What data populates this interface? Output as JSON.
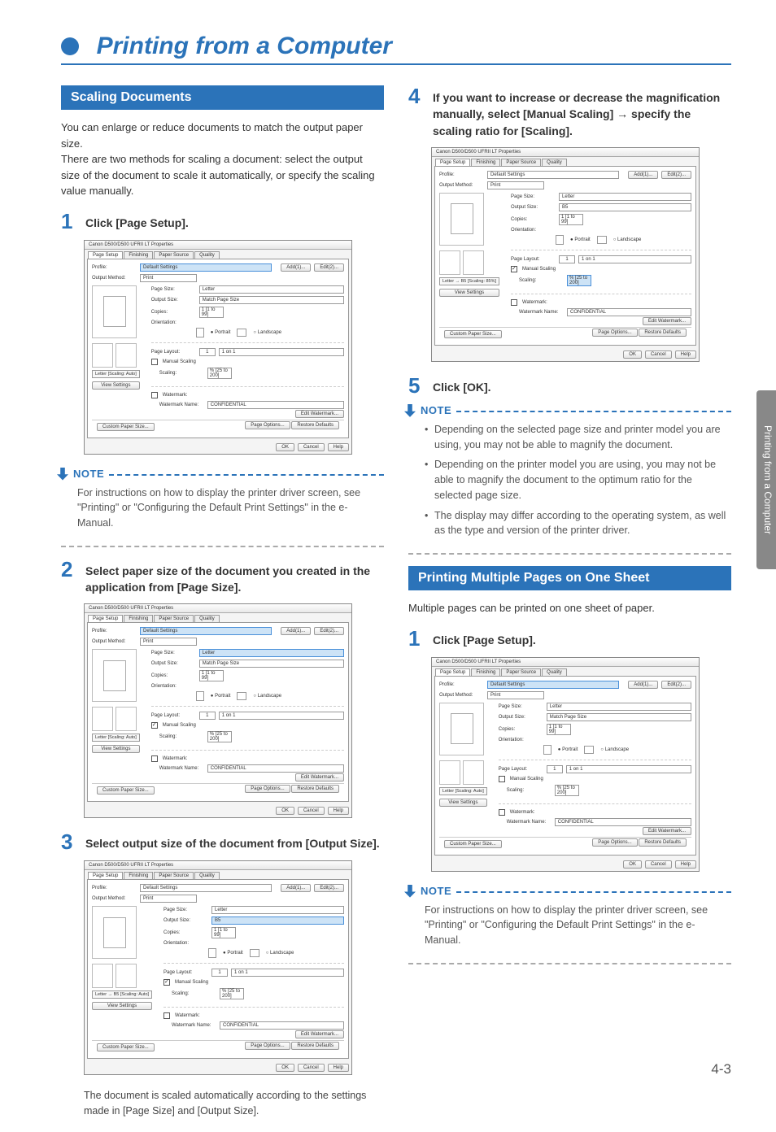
{
  "header": {
    "title": "Printing from a Computer"
  },
  "side_tab": "Printing from a Computer",
  "page_number": "4-3",
  "left": {
    "section_title": "Scaling Documents",
    "intro": "You can enlarge or reduce documents to match the output paper size.\nThere are two methods for scaling a document: select the output size of the document to scale it automatically, or specify the scaling value manually.",
    "step1": {
      "num": "1",
      "text": "Click [Page Setup]."
    },
    "step2": {
      "num": "2",
      "text": "Select paper size of the document you created in the application from [Page Size]."
    },
    "step3": {
      "num": "3",
      "text": "Select output size of the document from [Output Size]."
    },
    "step3_note": "The document is scaled automatically according to the settings made in [Page Size] and [Output Size].",
    "note_label": "NOTE",
    "note_body": "For instructions on how to display the printer driver screen, see \"Printing\" or \"Configuring the Default Print Settings\" in the e-Manual."
  },
  "right": {
    "step4": {
      "num": "4",
      "text_a": "If you want to increase or decrease the magnification manually, select [Manual Scaling] ",
      "text_b": " specify the scaling ratio for [Scaling]."
    },
    "step5": {
      "num": "5",
      "text": "Click [OK]."
    },
    "note_label": "NOTE",
    "note_bullets": [
      "Depending on the selected page size and printer model you are using, you may not be able to magnify the document.",
      "Depending on the printer model you are using, you may not be able to magnify the document to the optimum ratio for the selected page size.",
      "The display may differ according to the operating system, as well as the type and version of the printer driver."
    ],
    "section2_title": "Printing Multiple Pages on One Sheet",
    "section2_intro": "Multiple pages can be printed on one sheet of paper.",
    "step1b": {
      "num": "1",
      "text": "Click [Page Setup]."
    },
    "note2_label": "NOTE",
    "note2_body": "For instructions on how to display the printer driver screen, see \"Printing\" or \"Configuring the Default Print Settings\" in the e-Manual."
  },
  "dialog_common": {
    "title": "Canon D500/D500 UFRII LT Properties",
    "tabs": [
      "Page Setup",
      "Finishing",
      "Paper Source",
      "Quality"
    ],
    "profile_label": "Profile:",
    "profile_value": "Default Settings",
    "add_btn": "Add(1)...",
    "edit_btn": "Edit(2)...",
    "output_label": "Output Method:",
    "output_value": "Print",
    "page_size_label": "Page Size:",
    "output_size_label": "Output Size:",
    "copies_label": "Copies:",
    "copies_value": "1 [1 to 99]",
    "orientation_label": "Orientation:",
    "portrait": "Portrait",
    "landscape": "Landscape",
    "page_layout_label": "Page Layout:",
    "page_layout_value": "1 on 1",
    "manual_scaling_label": "Manual Scaling",
    "scaling_label": "Scaling:",
    "watermark_label": "Watermark:",
    "watermark_name_label": "Watermark Name:",
    "watermark_value": "CONFIDENTIAL",
    "edit_watermark_btn": "Edit Watermark...",
    "view_settings_btn": "View Settings",
    "custom_paper_btn": "Custom Paper Size...",
    "page_options_btn": "Page Options...",
    "restore_btn": "Restore Defaults",
    "ok_btn": "OK",
    "cancel_btn": "Cancel",
    "help_btn": "Help"
  },
  "dlg1": {
    "page_size_value": "Letter",
    "output_size_value": "Match Page Size",
    "scaling_value": "% [25 to 200]",
    "status": "Letter [Scaling: Auto]",
    "manual_checked": false
  },
  "dlg2": {
    "page_size_value": "Letter",
    "output_size_value": "Match Page Size",
    "scaling_value": "% [25 to 200]",
    "status": "Letter [Scaling: Auto]",
    "manual_checked": true
  },
  "dlg3": {
    "page_size_value": "Letter",
    "output_size_value": "B5",
    "scaling_value": "% [25 to 200]",
    "status": "Letter → B5 [Scaling: Auto]",
    "manual_checked": true
  },
  "dlg4": {
    "page_size_value": "Letter",
    "output_size_value": "B5",
    "scaling_value": "% [25 to 200]",
    "status": "Letter → B5 [Scaling: 85%]",
    "manual_checked": true,
    "scaling_hi": true
  },
  "dlg5": {
    "page_size_value": "Letter",
    "output_size_value": "Match Page Size",
    "scaling_value": "% [25 to 200]",
    "status": "Letter [Scaling: Auto]",
    "manual_checked": false
  }
}
